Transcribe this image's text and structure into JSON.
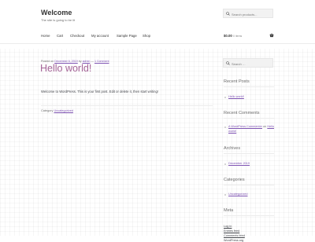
{
  "site": {
    "title": "Welcome",
    "description": "The site is going to be lit"
  },
  "header_search": {
    "placeholder": "Search products..."
  },
  "nav": {
    "items": [
      "Home",
      "Cart",
      "Checkout",
      "My account",
      "Sample Page",
      "Shop"
    ]
  },
  "cart": {
    "amount": "$0.00",
    "count": "0 items"
  },
  "post": {
    "meta_prefix": "Posted on",
    "date": "December 6, 2019",
    "by": "by",
    "author": "admin",
    "sep": "—",
    "comments": "1 Comment",
    "title": "Hello world!",
    "body": "Welcome to WordPress. This is your first post. Edit or delete it, then start writing!",
    "category_label": "Category",
    "category": "Uncategorized"
  },
  "sidebar": {
    "search_placeholder": "Search …",
    "recent_posts_title": "Recent Posts",
    "recent_posts": [
      "Hello world!"
    ],
    "recent_comments_title": "Recent Comments",
    "comment_author": "A WordPress Commenter",
    "comment_on": "on",
    "comment_post": "Hello world!",
    "archives_title": "Archives",
    "archives": [
      "December 2019"
    ],
    "categories_title": "Categories",
    "categories": [
      "Uncategorized"
    ],
    "meta_title": "Meta",
    "meta_links": [
      "Log in",
      "Entries feed",
      "Comments feed",
      "WordPress.org"
    ]
  },
  "colors": {
    "accent": "#7f54b3",
    "title_purple": "#a46497",
    "text": "#43454b"
  }
}
